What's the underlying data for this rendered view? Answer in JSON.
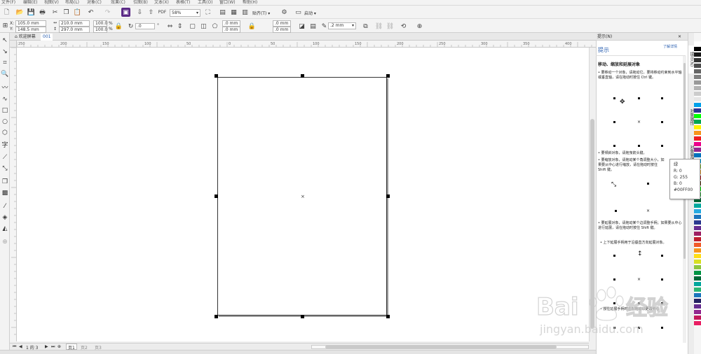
{
  "menubar": {
    "items": [
      "文件(F)",
      "编辑(E)",
      "视图(V)",
      "布局(L)",
      "对象(C)",
      "效果(C)",
      "位图(B)",
      "文本(X)",
      "表格(T)",
      "工具(O)",
      "窗口(W)",
      "帮助(H)"
    ]
  },
  "toolbar": {
    "zoom_value": "58%",
    "snap_label": "贴齐(T)",
    "launch_label": "启动"
  },
  "property_bar": {
    "x_label": "X:",
    "x_value": "105.0 mm",
    "y_label": "Y:",
    "y_value": "148.5 mm",
    "width_value": "210.0 mm",
    "height_value": "297.0 mm",
    "scale_x": "100.0",
    "scale_y": "100.0",
    "percent": "%",
    "rotation_value": ".0",
    "degree": "°",
    "corner_1": ".0 mm",
    "corner_2": ".0 mm",
    "corner_3": ".0 mm",
    "corner_4": ".0 mm",
    "outline_width": ".2 mm"
  },
  "doc_tabs": {
    "welcome": "欢迎屏幕",
    "document": "001"
  },
  "ruler": {
    "h_ticks": [
      "250",
      "200",
      "150",
      "100",
      "50",
      "0",
      "50",
      "100",
      "150",
      "200",
      "250",
      "300",
      "350",
      "400"
    ]
  },
  "page_nav": {
    "counter": "1 的 3",
    "pages": [
      "页1",
      "页2",
      "页3"
    ]
  },
  "docker": {
    "title": "提示(N)",
    "header": "提示",
    "learn_more": "了解详情",
    "section_title": "移动、缩放和延展对象",
    "para1": "• 要移动一个对象，请拖动它。要将移动约束到水平轴或垂直轴，请在拖动时按住 Ctrl 键。",
    "para2": "• 要倾斜对象，请拖曳箭头键。",
    "para3": "• 要缩放对象，请拖动某个角调整大小，如果要从中心进行缩放，请在拖动时按住 Shift 键。",
    "para4": "• 要延展对象，请拖动某个边调整手柄；如果要从中心进行延展，请在拖动时按住 Shift 键。",
    "para5": "• 上下延展手柄用于沿垂直方向延展对象。",
    "para6": "• 按住延展手柄时左右拖动以更改中心"
  },
  "side_tabs": [
    "提示(N)",
    "对象属性",
    "对象管理器"
  ],
  "tooltip": {
    "name": "绿",
    "r": "R: 0",
    "g": "G: 255",
    "b": "B: 0",
    "hex": "#00FF00"
  },
  "palette": [
    "#ffffff",
    "#000000",
    "#1a1a1a",
    "#333333",
    "#4d4d4d",
    "#666666",
    "#808080",
    "#999999",
    "#b3b3b3",
    "#cccccc",
    "#e6e6e6",
    "#00a0e9",
    "#2e3192",
    "#00ff00",
    "#00a651",
    "#fff200",
    "#f7941d",
    "#ed1c24",
    "#ec008c",
    "#92278f",
    "#0072bc",
    "#00aeef",
    "#8dc63f",
    "#fbb040",
    "#c1272d",
    "#603913",
    "#00ff00",
    "#39b54a",
    "#006838",
    "#00a99d",
    "#27aae1",
    "#1c75bc",
    "#2b3990",
    "#662d91",
    "#9e1f63",
    "#be1e2d",
    "#f15a29",
    "#f7941d",
    "#ffde17",
    "#d7df23",
    "#8dc63f",
    "#009444",
    "#006838",
    "#00a79d",
    "#2bb673",
    "#1b75bc",
    "#262262",
    "#662d91",
    "#92278f",
    "#c2185b",
    "#e91e63"
  ]
}
